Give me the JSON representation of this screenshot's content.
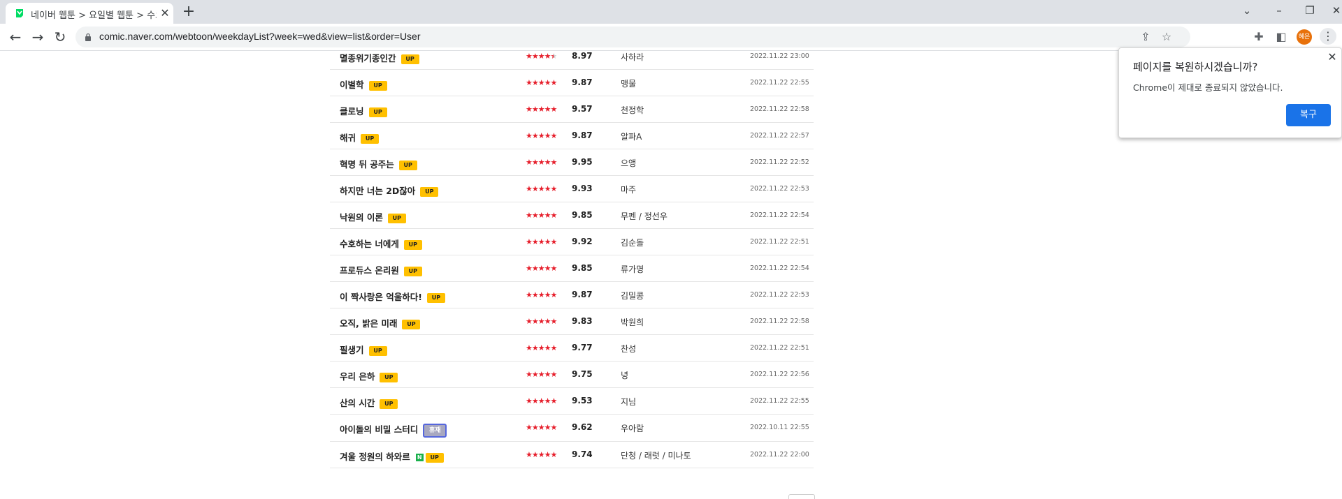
{
  "browser": {
    "tab_title": "네이버 웹툰 > 요일별 웹툰 > 수요",
    "url": "comic.naver.com/webtoon/weekdayList?week=wed&view=list&order=User",
    "profile_initial": "혜은"
  },
  "webtoons": [
    {
      "title": "멸종위기종인간",
      "badge": "UP",
      "rating": "8.97",
      "author": "사하라",
      "date": "2022.11.22 23:00",
      "stars": 4.5
    },
    {
      "title": "이별학",
      "badge": "UP",
      "rating": "9.87",
      "author": "맹물",
      "date": "2022.11.22 22:55",
      "stars": 5
    },
    {
      "title": "클로닝",
      "badge": "UP",
      "rating": "9.57",
      "author": "천정학",
      "date": "2022.11.22 22:58",
      "stars": 5
    },
    {
      "title": "해귀",
      "badge": "UP",
      "rating": "9.87",
      "author": "알파A",
      "date": "2022.11.22 22:57",
      "stars": 5
    },
    {
      "title": "혁명 뒤 공주는",
      "badge": "UP",
      "rating": "9.95",
      "author": "으앵",
      "date": "2022.11.22 22:52",
      "stars": 5
    },
    {
      "title": "하지만 너는 2D잖아",
      "badge": "UP",
      "rating": "9.93",
      "author": "마주",
      "date": "2022.11.22 22:53",
      "stars": 5
    },
    {
      "title": "낙원의 이론",
      "badge": "UP",
      "rating": "9.85",
      "author": "무펜 / 정선우",
      "date": "2022.11.22 22:54",
      "stars": 5
    },
    {
      "title": "수호하는 너에게",
      "badge": "UP",
      "rating": "9.92",
      "author": "김순돌",
      "date": "2022.11.22 22:51",
      "stars": 5
    },
    {
      "title": "프로듀스 온리원",
      "badge": "UP",
      "rating": "9.85",
      "author": "류가명",
      "date": "2022.11.22 22:54",
      "stars": 5
    },
    {
      "title": "이 짝사랑은 억울하다!",
      "badge": "UP",
      "rating": "9.87",
      "author": "김밀콩",
      "date": "2022.11.22 22:53",
      "stars": 5
    },
    {
      "title": "오직, 밝은 미래",
      "badge": "UP",
      "rating": "9.83",
      "author": "박원희",
      "date": "2022.11.22 22:58",
      "stars": 5
    },
    {
      "title": "필생기",
      "badge": "UP",
      "rating": "9.77",
      "author": "찬성",
      "date": "2022.11.22 22:51",
      "stars": 5
    },
    {
      "title": "우리 은하",
      "badge": "UP",
      "rating": "9.75",
      "author": "녕",
      "date": "2022.11.22 22:56",
      "stars": 5
    },
    {
      "title": "산의 시간",
      "badge": "UP",
      "rating": "9.53",
      "author": "지님",
      "date": "2022.11.22 22:55",
      "stars": 5
    },
    {
      "title": "아이돌의 비밀 스터디",
      "badge": "휴재",
      "rating": "9.62",
      "author": "우아람",
      "date": "2022.10.11 22:55",
      "stars": 5
    },
    {
      "title": "겨울 정원의 하와르",
      "badge": "UP",
      "new_badge": "N",
      "rating": "9.74",
      "author": "단청 / 래럿 / 미나토",
      "date": "2022.11.22 22:00",
      "stars": 5
    }
  ],
  "restore_dialog": {
    "title": "페이지를 복원하시겠습니까?",
    "message": "Chrome이 제대로 종료되지 않았습니다.",
    "button": "복구"
  }
}
